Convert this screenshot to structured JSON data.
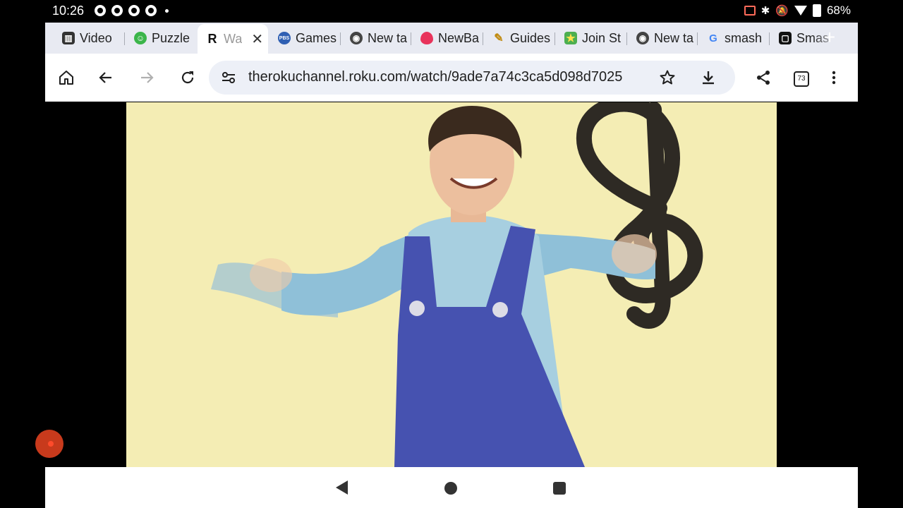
{
  "status": {
    "time": "10:26",
    "battery": "68%"
  },
  "tabs": [
    {
      "label": "Video",
      "favicon": "video-favicon",
      "color": "#333333"
    },
    {
      "label": "Puzzle",
      "favicon": "puzzle-favicon",
      "color": "#3bb54a"
    },
    {
      "label": "Wa",
      "favicon": "roku-favicon",
      "color": "#222222"
    },
    {
      "label": "Games",
      "favicon": "pbs-favicon",
      "color": "#2f5fb3"
    },
    {
      "label": "New ta",
      "favicon": "chrome-favicon",
      "color": "#444444"
    },
    {
      "label": "NewBa",
      "favicon": "fire-favicon",
      "color": "#e8335b"
    },
    {
      "label": "Guides",
      "favicon": "guides-favicon",
      "color": "#e0b020"
    },
    {
      "label": "Join St",
      "favicon": "star-favicon",
      "color": "#4caf50"
    },
    {
      "label": "New ta",
      "favicon": "chrome-favicon",
      "color": "#444444"
    },
    {
      "label": "smash",
      "favicon": "google-favicon",
      "color": "#4285f4"
    },
    {
      "label": "Smas",
      "favicon": "smash-favicon",
      "color": "#111111"
    }
  ],
  "toolbar": {
    "url": "therokuchannel.roku.com/watch/9ade7a74c3ca5d098d7025",
    "tab_count": "73"
  },
  "icons": {
    "home": "home-icon",
    "back": "back-icon",
    "forward": "forward-icon",
    "reload": "reload-icon",
    "site_settings": "tune-icon",
    "bookmark": "star-icon",
    "download": "download-icon",
    "share": "share-icon",
    "menu": "more-vert-icon"
  }
}
